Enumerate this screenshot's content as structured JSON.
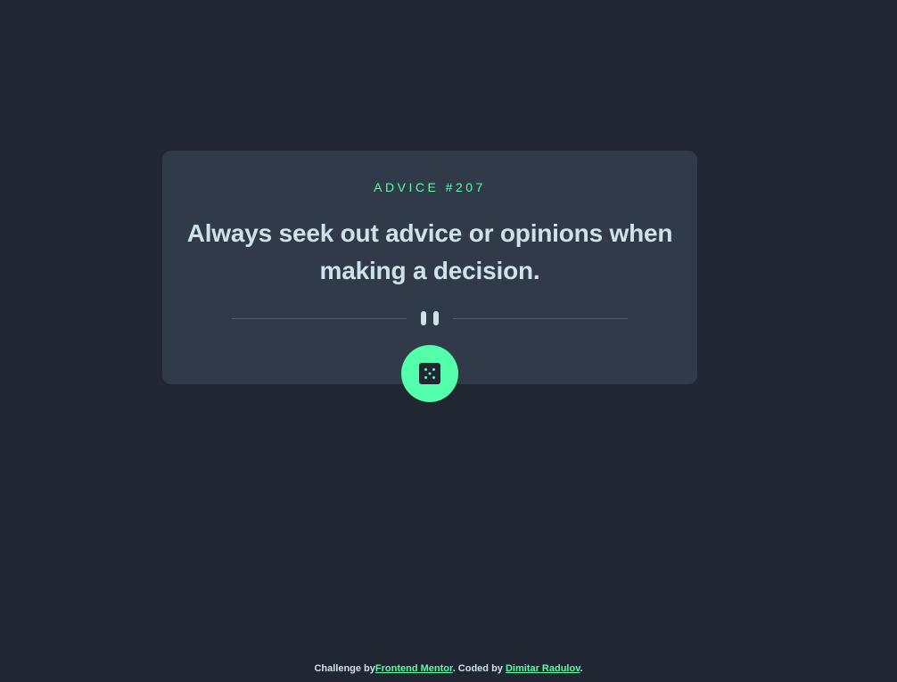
{
  "card": {
    "advice_label": "ADVICE #207",
    "quote": "Always seek out advice or opinions when making a decision."
  },
  "dice_button": {
    "icon": "dice-icon"
  },
  "footer": {
    "prefix": "Challenge by",
    "link1": "Frontend Mentor",
    "middle": ". Coded by ",
    "link2": "Dimitar Radulov",
    "suffix": "."
  },
  "colors": {
    "background": "#202733",
    "card": "#313a48",
    "accent": "#53ffaa",
    "text": "#cee3e9",
    "divider": "#4f5d74"
  }
}
